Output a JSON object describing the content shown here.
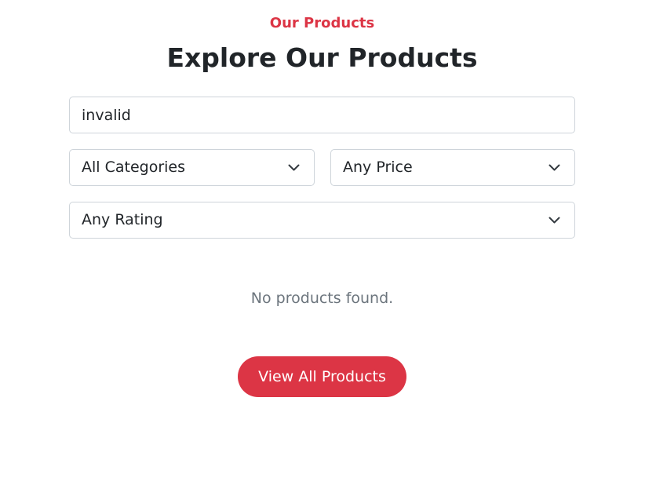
{
  "header": {
    "eyebrow": "Our Products",
    "title": "Explore Our Products"
  },
  "filters": {
    "search": {
      "value": "invalid"
    },
    "category": {
      "selected": "All Categories"
    },
    "price": {
      "selected": "Any Price"
    },
    "rating": {
      "selected": "Any Rating"
    }
  },
  "results": {
    "empty_message": "No products found."
  },
  "cta": {
    "label": "View All Products"
  },
  "colors": {
    "accent": "#dc3545",
    "heading": "#212529",
    "muted": "#6c757d",
    "border": "#ced4da"
  },
  "icons": {
    "dropdown": "chevron-down-icon"
  }
}
